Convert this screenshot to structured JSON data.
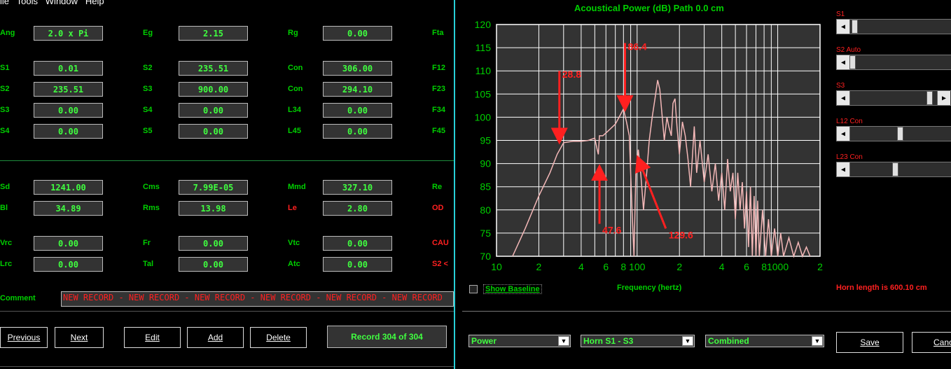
{
  "menubar": "ile   Tools   Window   Help",
  "left": {
    "row1": [
      {
        "label": "Ang",
        "value": "2.0 x Pi"
      },
      {
        "label": "Eg",
        "value": "2.15"
      },
      {
        "label": "Rg",
        "value": "0.00"
      },
      {
        "label": "Fta"
      }
    ],
    "rows": [
      [
        {
          "label": "S1",
          "value": "0.01"
        },
        {
          "label": "S2",
          "value": "235.51"
        },
        {
          "label": "Con",
          "value": "306.00"
        },
        {
          "label": "F12"
        }
      ],
      [
        {
          "label": "S2",
          "value": "235.51"
        },
        {
          "label": "S3",
          "value": "900.00"
        },
        {
          "label": "Con",
          "value": "294.10"
        },
        {
          "label": "F23"
        }
      ],
      [
        {
          "label": "S3",
          "value": "0.00"
        },
        {
          "label": "S4",
          "value": "0.00"
        },
        {
          "label": "L34",
          "value": "0.00"
        },
        {
          "label": "F34"
        }
      ],
      [
        {
          "label": "S4",
          "value": "0.00"
        },
        {
          "label": "S5",
          "value": "0.00"
        },
        {
          "label": "L45",
          "value": "0.00"
        },
        {
          "label": "F45"
        }
      ]
    ],
    "driver": [
      [
        {
          "label": "Sd",
          "value": "1241.00"
        },
        {
          "label": "Cms",
          "value": "7.99E-05"
        },
        {
          "label": "Mmd",
          "value": "327.10"
        },
        {
          "label": "Re"
        }
      ],
      [
        {
          "label": "Bl",
          "value": "34.89"
        },
        {
          "label": "Rms",
          "value": "13.98"
        },
        {
          "label": "Le",
          "value": "2.80"
        },
        {
          "label": "OD"
        }
      ]
    ],
    "chambers": [
      [
        {
          "label": "Vrc",
          "value": "0.00"
        },
        {
          "label": "Fr",
          "value": "0.00"
        },
        {
          "label": "Vtc",
          "value": "0.00"
        },
        {
          "label": "CAU"
        }
      ],
      [
        {
          "label": "Lrc",
          "value": "0.00"
        },
        {
          "label": "Tal",
          "value": "0.00"
        },
        {
          "label": "Atc",
          "value": "0.00"
        },
        {
          "label": "S2 <"
        }
      ]
    ],
    "comment_label": "Comment",
    "comment_value": "NEW RECORD - NEW RECORD - NEW RECORD - NEW RECORD - NEW RECORD - NEW RECORD",
    "buttons": {
      "previous": "Previous",
      "next": "Next",
      "edit": "Edit",
      "add": "Add",
      "delete": "Delete"
    },
    "record": "Record 304 of 304"
  },
  "chart_title": "Acoustical Power (dB)   Path 0.0 cm",
  "chart_data": {
    "type": "line",
    "title": "Acoustical Power (dB)   Path 0.0 cm",
    "xlabel": "Frequency (hertz)",
    "ylabel": "",
    "xscale": "log",
    "xlim": [
      10,
      2000
    ],
    "ylim": [
      70,
      120
    ],
    "yticks": [
      70,
      75,
      80,
      85,
      90,
      95,
      100,
      105,
      110,
      115,
      120
    ],
    "xtick_labels": [
      {
        "v": 10,
        "t": "10"
      },
      {
        "v": 20,
        "t": "2"
      },
      {
        "v": 40,
        "t": "4"
      },
      {
        "v": 60,
        "t": "6"
      },
      {
        "v": 80,
        "t": "8"
      },
      {
        "v": 100,
        "t": "100"
      },
      {
        "v": 200,
        "t": "2"
      },
      {
        "v": 400,
        "t": "4"
      },
      {
        "v": 600,
        "t": "6"
      },
      {
        "v": 800,
        "t": "8"
      },
      {
        "v": 1000,
        "t": "1000"
      },
      {
        "v": 2000,
        "t": "2"
      }
    ],
    "grid": true,
    "series": [
      {
        "color": "#f4b8b8",
        "points": [
          [
            13,
            70
          ],
          [
            16,
            76
          ],
          [
            20,
            83
          ],
          [
            24,
            88
          ],
          [
            27,
            92
          ],
          [
            30,
            94.5
          ],
          [
            35,
            94.8
          ],
          [
            40,
            94.8
          ],
          [
            45,
            95
          ],
          [
            50,
            95.5
          ],
          [
            52,
            93
          ],
          [
            53,
            92
          ],
          [
            54,
            96
          ],
          [
            57,
            96
          ],
          [
            62,
            97
          ],
          [
            70,
            98.5
          ],
          [
            76,
            100.5
          ],
          [
            80,
            101.8
          ],
          [
            84,
            99
          ],
          [
            88,
            96
          ],
          [
            92,
            80
          ],
          [
            95,
            70
          ],
          [
            98,
            88
          ],
          [
            102,
            93
          ],
          [
            106,
            88
          ],
          [
            111,
            80
          ],
          [
            117,
            88
          ],
          [
            122,
            95
          ],
          [
            128,
            100
          ],
          [
            134,
            104
          ],
          [
            140,
            108
          ],
          [
            145,
            106
          ],
          [
            150,
            101
          ],
          [
            156,
            95
          ],
          [
            163,
            100
          ],
          [
            168,
            98
          ],
          [
            175,
            96
          ],
          [
            180,
            103
          ],
          [
            186,
            104
          ],
          [
            192,
            98
          ],
          [
            200,
            92
          ],
          [
            210,
            99
          ],
          [
            220,
            96
          ],
          [
            230,
            91
          ],
          [
            240,
            85
          ],
          [
            255,
            98
          ],
          [
            265,
            88
          ],
          [
            280,
            95
          ],
          [
            300,
            86
          ],
          [
            320,
            92
          ],
          [
            340,
            84
          ],
          [
            360,
            90
          ],
          [
            380,
            82
          ],
          [
            400,
            88
          ],
          [
            420,
            80
          ],
          [
            440,
            91
          ],
          [
            460,
            84
          ],
          [
            480,
            88
          ],
          [
            500,
            78
          ],
          [
            520,
            88
          ],
          [
            540,
            80
          ],
          [
            560,
            86
          ],
          [
            580,
            76
          ],
          [
            600,
            84
          ],
          [
            620,
            72
          ],
          [
            640,
            85
          ],
          [
            660,
            70
          ],
          [
            680,
            83
          ],
          [
            700,
            70
          ],
          [
            720,
            82
          ],
          [
            740,
            70
          ],
          [
            780,
            80
          ],
          [
            820,
            70
          ],
          [
            860,
            78
          ],
          [
            900,
            70
          ],
          [
            950,
            76
          ],
          [
            1000,
            70
          ],
          [
            1050,
            75
          ],
          [
            1100,
            70
          ],
          [
            1200,
            74
          ],
          [
            1300,
            70
          ],
          [
            1400,
            73
          ],
          [
            1500,
            70
          ],
          [
            1600,
            72
          ],
          [
            1700,
            70
          ]
        ]
      }
    ],
    "annotations": [
      {
        "text": "28.8",
        "x": 28,
        "y": 95,
        "from_y": 110
      },
      {
        "text": "86.4",
        "x": 82,
        "y": 102,
        "from_y": 116
      },
      {
        "text": "47.6",
        "x": 54,
        "y": 89,
        "from_y": 77
      },
      {
        "text": "129.6",
        "x": 102,
        "y": 91,
        "from_y": 76
      }
    ]
  },
  "sliders": [
    {
      "label": "S1",
      "position": 0.03
    },
    {
      "label": "S2 Auto",
      "position": 0.0
    },
    {
      "label": "S3",
      "position": 1.0
    },
    {
      "label": "L12 Con",
      "position": 0.62
    },
    {
      "label": "L23 Con",
      "position": 0.55
    }
  ],
  "show_baseline": "Show Baseline",
  "horn_length": "Horn length is 600.10 cm",
  "dropdowns": [
    "Power",
    "Horn S1 - S3",
    "Combined"
  ],
  "save_label": "Save",
  "cancel_label": "Canc",
  "colors": {
    "field_text": "#40ff40",
    "label": "#00d000",
    "accent_red": "#ff2020",
    "divider": "#27d0d8",
    "curve": "#f4b8b8"
  }
}
